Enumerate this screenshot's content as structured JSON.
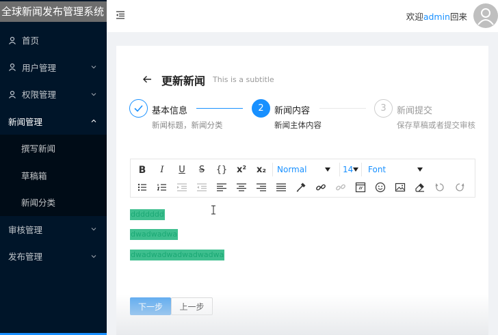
{
  "app": {
    "title": "全球新闻发布管理系统"
  },
  "sidebar": {
    "items": [
      {
        "label": "首页",
        "icon": "user-icon"
      },
      {
        "label": "用户管理",
        "icon": "user-icon"
      },
      {
        "label": "权限管理",
        "icon": "user-icon"
      },
      {
        "label": "新闻管理"
      },
      {
        "label": "审核管理"
      },
      {
        "label": "发布管理"
      }
    ],
    "news_submenu": [
      {
        "label": "撰写新闻"
      },
      {
        "label": "草稿箱"
      },
      {
        "label": "新闻分类"
      }
    ]
  },
  "header": {
    "welcome_prefix": "欢迎",
    "username": "admin",
    "welcome_suffix": "回来"
  },
  "page": {
    "title": "更新新闻",
    "subtitle": "This is a subtitle"
  },
  "steps": [
    {
      "title": "基本信息",
      "desc": "新闻标题，新闻分类",
      "status": "done"
    },
    {
      "number": "2",
      "title": "新闻内容",
      "desc": "新闻主体内容",
      "status": "active"
    },
    {
      "number": "3",
      "title": "新闻提交",
      "desc": "保存草稿或者提交审核",
      "status": "wait"
    }
  ],
  "toolbar": {
    "bold": "B",
    "italic": "I",
    "underline": "U",
    "strike": "S",
    "code": "{}",
    "superscript": "x²",
    "subscript": "x₂",
    "block_type": "Normal",
    "font_size": "14",
    "font_family": "Font"
  },
  "editor": {
    "lines": [
      "ddddddd",
      "dwadwadwa",
      "dwadwadwadwadwadwa"
    ]
  },
  "actions": {
    "next_label": "下一步",
    "prev_label": "上一步"
  },
  "colors": {
    "primary": "#1890ff",
    "sidebar_bg": "#001529",
    "highlight": "#3fbf8f"
  }
}
